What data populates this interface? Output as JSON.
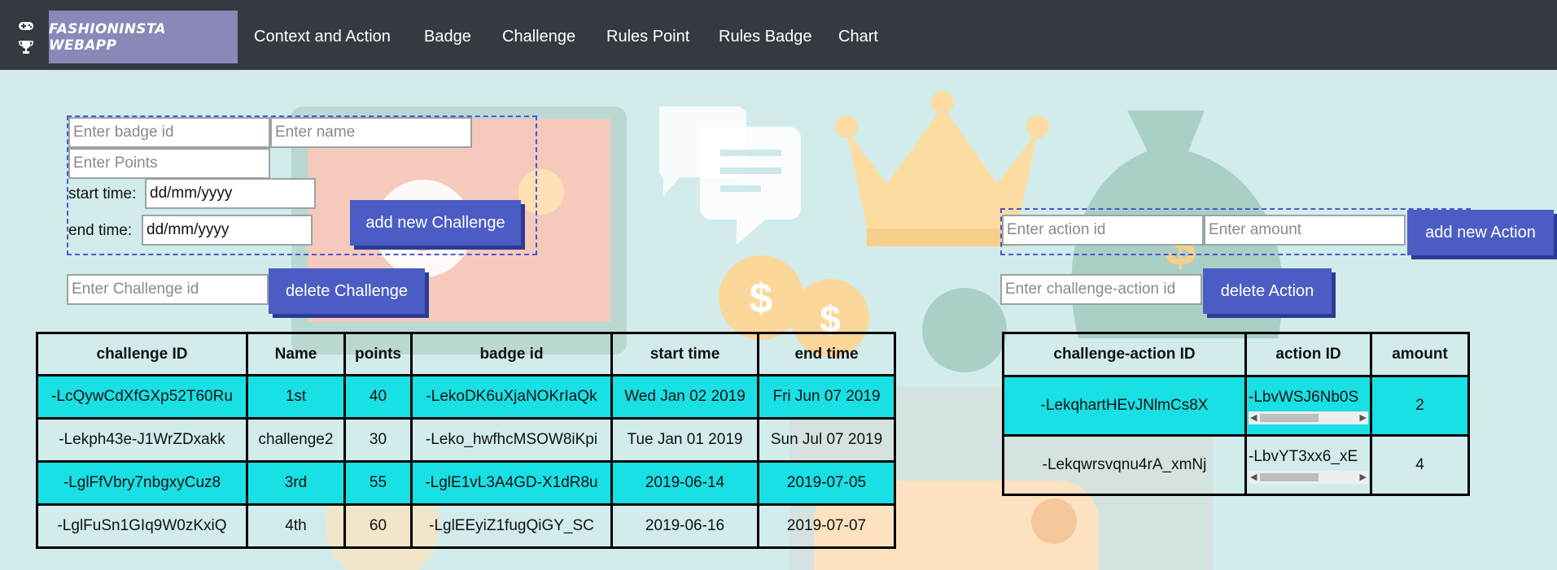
{
  "navbar": {
    "brand": "FASHIONINSTA WEBAPP",
    "links": [
      "Context and Action",
      "Badge",
      "Challenge",
      "Rules Point",
      "Rules Badge",
      "Chart"
    ]
  },
  "challenge_form": {
    "badge_id_placeholder": "Enter badge id",
    "name_placeholder": "Enter name",
    "points_placeholder": "Enter Points",
    "start_label": "start time:",
    "start_value": "dd/mm/yyyy",
    "end_label": "end time:",
    "end_value": "dd/mm/yyyy",
    "add_label": "add new Challenge",
    "delete_placeholder": "Enter Challenge id",
    "delete_label": "delete Challenge"
  },
  "action_form": {
    "action_id_placeholder": "Enter action id",
    "amount_placeholder": "Enter amount",
    "add_label": "add new Action",
    "delete_placeholder": "Enter challenge-action id",
    "delete_label": "delete Action"
  },
  "challenge_table": {
    "headers": [
      "challenge ID",
      "Name",
      "points",
      "badge id",
      "start time",
      "end time"
    ],
    "rows": [
      [
        "-LcQywCdXfGXp52T60Ru",
        "1st",
        "40",
        "-LekoDK6uXjaNOKrIaQk",
        "Wed Jan 02 2019",
        "Fri Jun 07 2019"
      ],
      [
        "-Lekph43e-J1WrZDxakk",
        "challenge2",
        "30",
        "-Leko_hwfhcMSOW8iKpi",
        "Tue Jan 01 2019",
        "Sun Jul 07 2019"
      ],
      [
        "-LglFfVbry7nbgxyCuz8",
        "3rd",
        "55",
        "-LglE1vL3A4GD-X1dR8u",
        "2019-06-14",
        "2019-07-05"
      ],
      [
        "-LglFuSn1GIq9W0zKxiQ",
        "4th",
        "60",
        "-LglEEyiZ1fugQiGY_SC",
        "2019-06-16",
        "2019-07-07"
      ]
    ]
  },
  "action_table": {
    "headers": [
      "challenge-action ID",
      "action ID",
      "amount"
    ],
    "rows": [
      [
        "-LekqhartHEvJNlmCs8X",
        "-LbvWSJ6Nb0S",
        "2"
      ],
      [
        "-Lekqwrsvqnu4rA_xmNj",
        "-LbvYT3xx6_xE",
        "4"
      ]
    ]
  },
  "colors": {
    "navbar": "#343a40",
    "brand_bg": "#8a87b9",
    "button": "#4b5dc4",
    "row_highlight": "#18e0e4",
    "page_bg": "#d2ecec",
    "dashed_border": "#4a58d6"
  },
  "icons": [
    "gamepad-icon",
    "trophy-icon"
  ]
}
